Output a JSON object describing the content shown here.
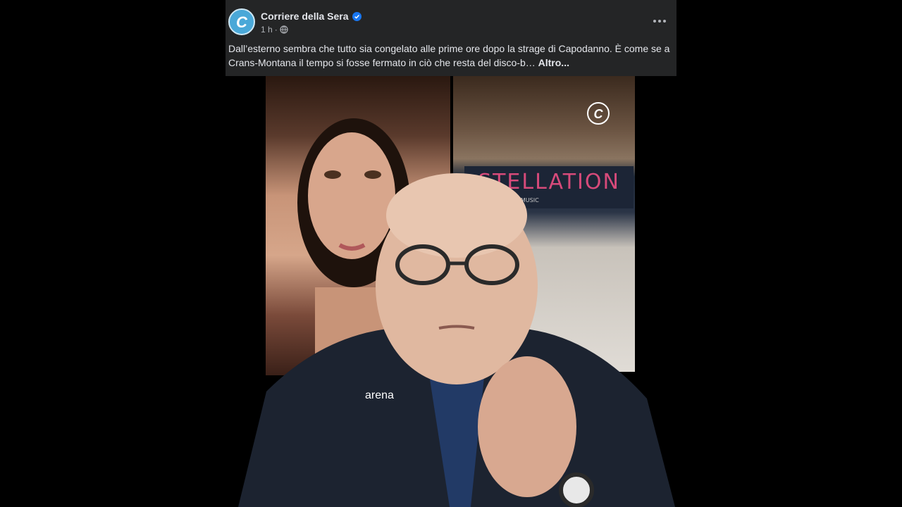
{
  "post": {
    "page_name": "Corriere della Sera",
    "logo_letter": "C",
    "time": "1 h",
    "separator": "·",
    "caption_text": "Dall’esterno sembra che tutto sia congelato alle prime ore dopo la strage di Capodanno. È come se a Crans-Montana il tempo si fosse fermato in ciò che resta del disco-b… ",
    "see_more_label": "Altro..."
  },
  "video": {
    "sign_text": "STELLATION",
    "sign_subtext": "LIVE MUSIC",
    "shirt_brand": "arena"
  },
  "colors": {
    "background": "#000000",
    "post_bg": "#242526",
    "text": "#e4e6eb",
    "muted": "#b0b3b8",
    "verified": "#1877f2",
    "logo_blue": "#4aa8d8"
  },
  "icons": [
    "corriere-logo-icon",
    "verified-badge-icon",
    "globe-icon",
    "more-options-icon"
  ]
}
